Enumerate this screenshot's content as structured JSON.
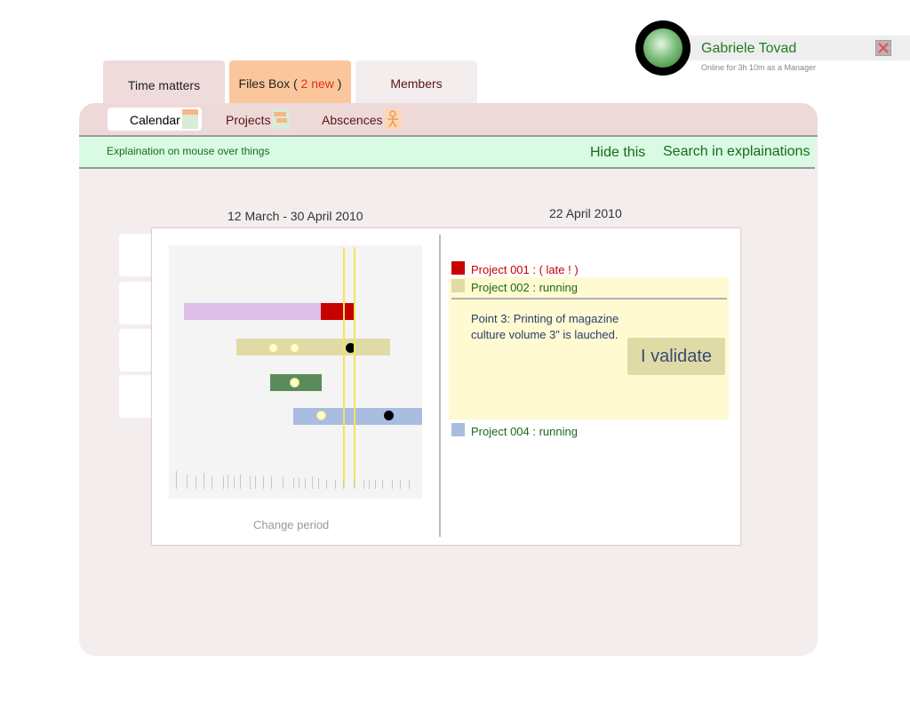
{
  "user": {
    "name": "Gabriele Tovad",
    "status": "Online for 3h 10m   as a Manager"
  },
  "tabs": {
    "time_matters": "Time matters",
    "files_box_prefix": "Files Box ( ",
    "files_box_new": "2 new",
    "files_box_suffix": " )",
    "members": "Members"
  },
  "subnav": {
    "calendar": "Calendar",
    "projects": "Projects",
    "abscences": "Abscences"
  },
  "help": {
    "text": "Explaination on mouse over things",
    "hide": "Hide this",
    "search": "Search in explainations"
  },
  "calendar": {
    "period": "12 March - 30 April 2010",
    "day": "22 April 2010",
    "change_period": "Change period"
  },
  "projects": [
    {
      "label": "Project 001 : ( late ! )",
      "color": "#c80000",
      "text_color": "#c80000"
    },
    {
      "label": "Project 002 : running",
      "color": "#e0dba6",
      "text_color": "#1a6a1a"
    },
    {
      "label": "Project 004 : running",
      "color": "#a8bde0",
      "text_color": "#1a6a1a"
    }
  ],
  "detail": {
    "text": "Point 3: Printing of magazine culture volume 3” is lauched.",
    "validate": "I validate"
  },
  "colors": {
    "bar_purple": "#dcbee8",
    "bar_red": "#c80000",
    "bar_khaki": "#e0dba6",
    "bar_green": "#5a8c5a",
    "bar_blue": "#a8bde0",
    "today_line": "#f2e65a"
  }
}
